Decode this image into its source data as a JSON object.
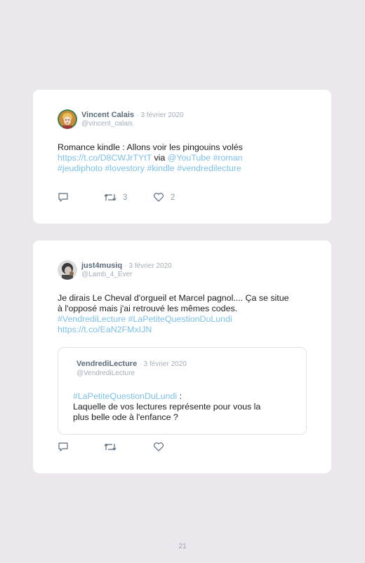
{
  "tweets": [
    {
      "author": "Vincent Calais",
      "date": "3 février 2020",
      "handle": "@vincent_calais",
      "lines": [
        [
          {
            "t": "Romance kindle : Allons voir les pingouins volés",
            "link": false
          }
        ],
        [
          {
            "t": "https://t.co/D8CWJrTYtT",
            "link": true
          },
          {
            "t": " via ",
            "link": false
          },
          {
            "t": "@YouTube",
            "link": true
          },
          {
            "t": " ",
            "link": false
          },
          {
            "t": "#roman",
            "link": true
          }
        ],
        [
          {
            "t": "#jeudiphoto",
            "link": true
          },
          {
            "t": " ",
            "link": false
          },
          {
            "t": "#lovestory",
            "link": true
          },
          {
            "t": " ",
            "link": false
          },
          {
            "t": "#kindle",
            "link": true
          },
          {
            "t": " ",
            "link": false
          },
          {
            "t": "#vendredilecture",
            "link": true
          }
        ]
      ],
      "retweets": "3",
      "likes": "2"
    },
    {
      "author": "just4musiq",
      "date": "3 février 2020",
      "handle": "@Lamb_4_Ever",
      "lines": [
        [
          {
            "t": "Je dirais Le Cheval d'orgueil et Marcel pagnol.... Ça se situe",
            "link": false
          }
        ],
        [
          {
            "t": "à l'opposé mais j'ai retrouvé les mêmes codes.",
            "link": false
          }
        ],
        [
          {
            "t": "#VendrediLecture",
            "link": true
          },
          {
            "t": " ",
            "link": false
          },
          {
            "t": "#LaPetiteQuestionDuLundi",
            "link": true
          }
        ],
        [
          {
            "t": "https://t.co/EaN2FMxIJN",
            "link": true
          }
        ]
      ],
      "quoted": {
        "author": "VendrediLecture",
        "date": "3 février 2020",
        "handle": "@VendrediLecture",
        "lines": [
          [
            {
              "t": "#LaPetiteQuestionDuLundi",
              "link": true
            },
            {
              "t": " :",
              "link": false
            }
          ],
          [
            {
              "t": "Laquelle de vos lectures représente pour vous la",
              "link": false
            }
          ],
          [
            {
              "t": "plus belle ode à l'enfance ?",
              "link": false
            }
          ]
        ]
      },
      "retweets": "",
      "likes": ""
    }
  ],
  "page_number": "21",
  "colors": {
    "background": "#ebe7ec",
    "card": "#ffffff",
    "link": "#7cc0e8",
    "meta": "#a3adb8",
    "name": "#5b6b7c"
  },
  "icons": [
    "reply-icon",
    "retweet-icon",
    "like-icon"
  ]
}
